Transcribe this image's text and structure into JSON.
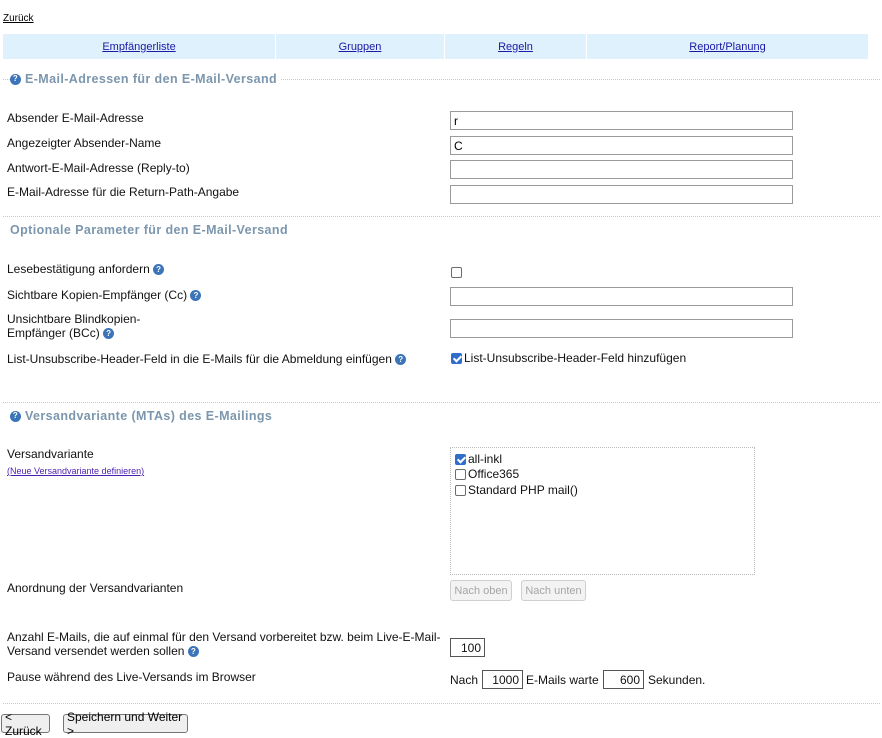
{
  "nav": {
    "back_link": "Zurück"
  },
  "tabs": [
    {
      "label": "Empfängerliste"
    },
    {
      "label": "Gruppen"
    },
    {
      "label": "Regeln"
    },
    {
      "label": "Report/Planung"
    }
  ],
  "section_addresses": {
    "title": "E-Mail-Adressen für den E-Mail-Versand",
    "fields": [
      {
        "label": "Absender E-Mail-Adresse",
        "value": "r"
      },
      {
        "label": "Angezeigter Absender-Name",
        "value": "C"
      },
      {
        "label": "Antwort-E-Mail-Adresse (Reply-to)",
        "value": ""
      },
      {
        "label": "E-Mail-Adresse für die Return-Path-Angabe",
        "value": ""
      }
    ]
  },
  "section_optional": {
    "title": "Optionale Parameter für den E-Mail-Versand",
    "read_receipt": {
      "label": "Lesebestätigung anfordern",
      "checked": false
    },
    "cc": {
      "label": "Sichtbare Kopien-Empfänger (Cc)",
      "value": ""
    },
    "bcc": {
      "label_line1": "Unsichtbare Blindkopien-",
      "label_line2": "Empfänger (BCc)",
      "value": ""
    },
    "unsubscribe": {
      "label": "List-Unsubscribe-Header-Feld in die E-Mails für die Abmeldung einfügen",
      "checkbox_label": "List-Unsubscribe-Header-Feld hinzufügen",
      "checked": true
    }
  },
  "section_mta": {
    "title": "Versandvariante (MTAs) des E-Mailings",
    "variant_label": "Versandvariante",
    "new_variant_link": "(Neue Versandvariante definieren)",
    "variants": [
      {
        "label": "all-inkl",
        "checked": true
      },
      {
        "label": "Office365",
        "checked": false
      },
      {
        "label": "Standard PHP mail()",
        "checked": false
      }
    ],
    "order_label": "Anordnung der Versandvarianten",
    "up_button": "Nach oben",
    "down_button": "Nach unten",
    "batch_label_line1": "Anzahl E-Mails, die auf einmal für den Versand vorbereitet bzw. beim Live-E-Mail-",
    "batch_label_line2": "Versand versendet werden sollen",
    "batch_value": "100",
    "pause_label": "Pause während des Live-Versands im Browser",
    "pause_prefix": "Nach",
    "pause_count": "1000",
    "pause_middle": "E-Mails warte",
    "pause_seconds": "600",
    "pause_suffix": "Sekunden."
  },
  "footer": {
    "back_button": "< Zurück",
    "save_button": "Speichern und Weiter >"
  },
  "colors": {
    "tab_bar": "#dff1fc",
    "section_title": "#7b96ad",
    "help_icon": "#3b74b8",
    "checkbox_on": "#2f6ecb"
  }
}
